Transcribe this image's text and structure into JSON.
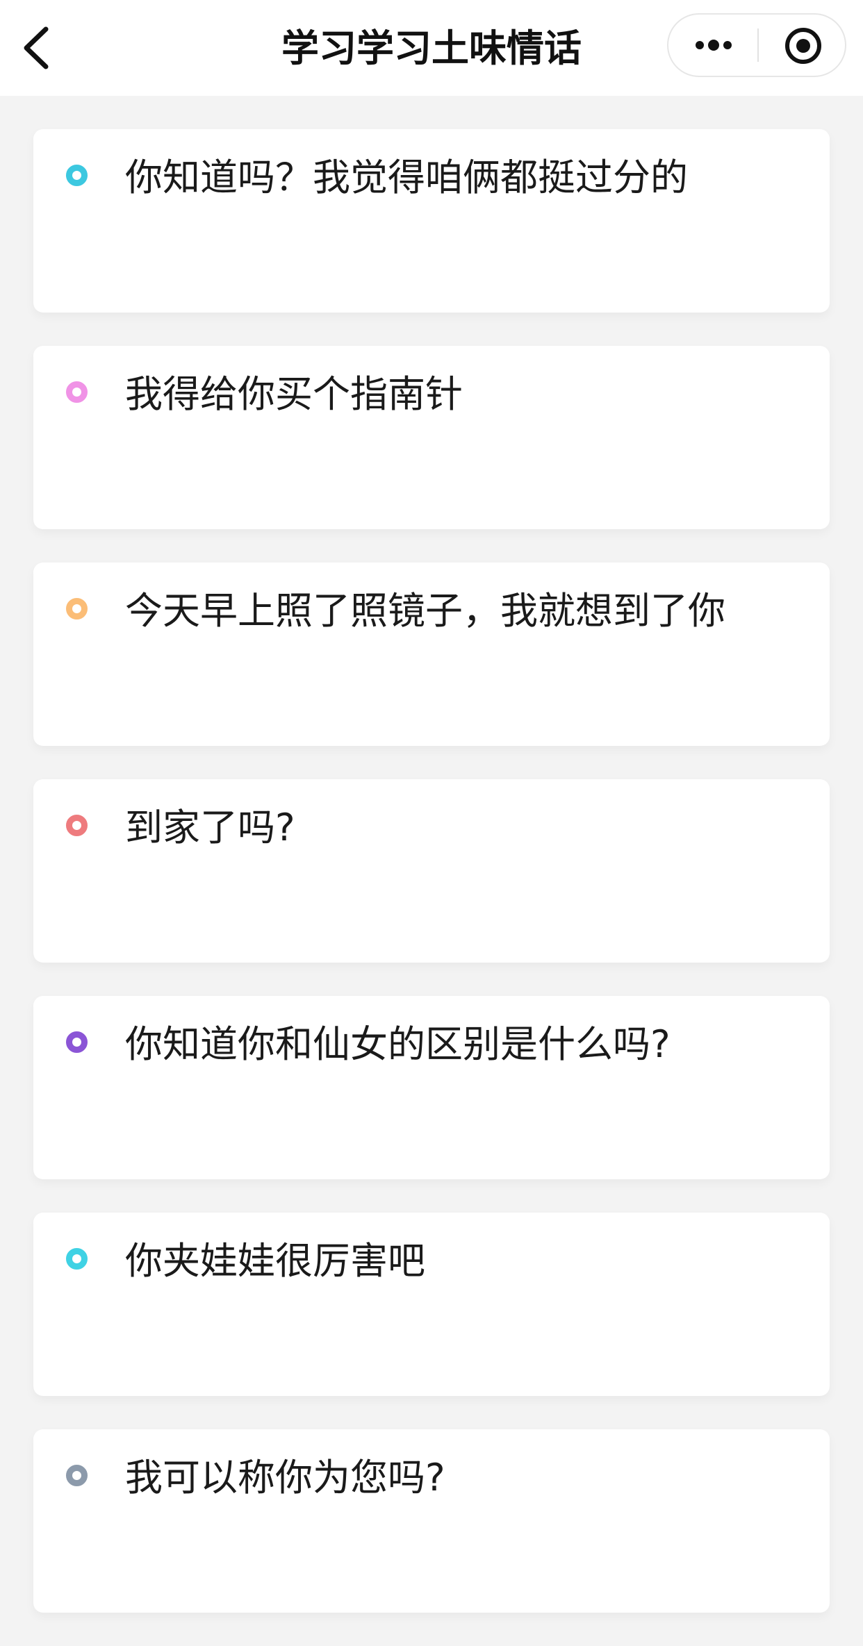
{
  "header": {
    "title": "学习学习土味情话",
    "back_icon": "chevron-left-icon",
    "more_icon": "more-dots-icon",
    "close_icon": "target-circle-icon"
  },
  "items": [
    {
      "text": "你知道吗？我觉得咱俩都挺过分的",
      "color": "#3cc8e0"
    },
    {
      "text": "我得给你买个指南针",
      "color": "#f093e6"
    },
    {
      "text": "今天早上照了照镜子，我就想到了你",
      "color": "#fbbd77"
    },
    {
      "text": "到家了吗?",
      "color": "#ee7b7e"
    },
    {
      "text": "你知道你和仙女的区别是什么吗?",
      "color": "#8b55d6"
    },
    {
      "text": "你夹娃娃很厉害吧",
      "color": "#3fd2e4"
    },
    {
      "text": "我可以称你为您吗?",
      "color": "#8c9aab"
    }
  ]
}
